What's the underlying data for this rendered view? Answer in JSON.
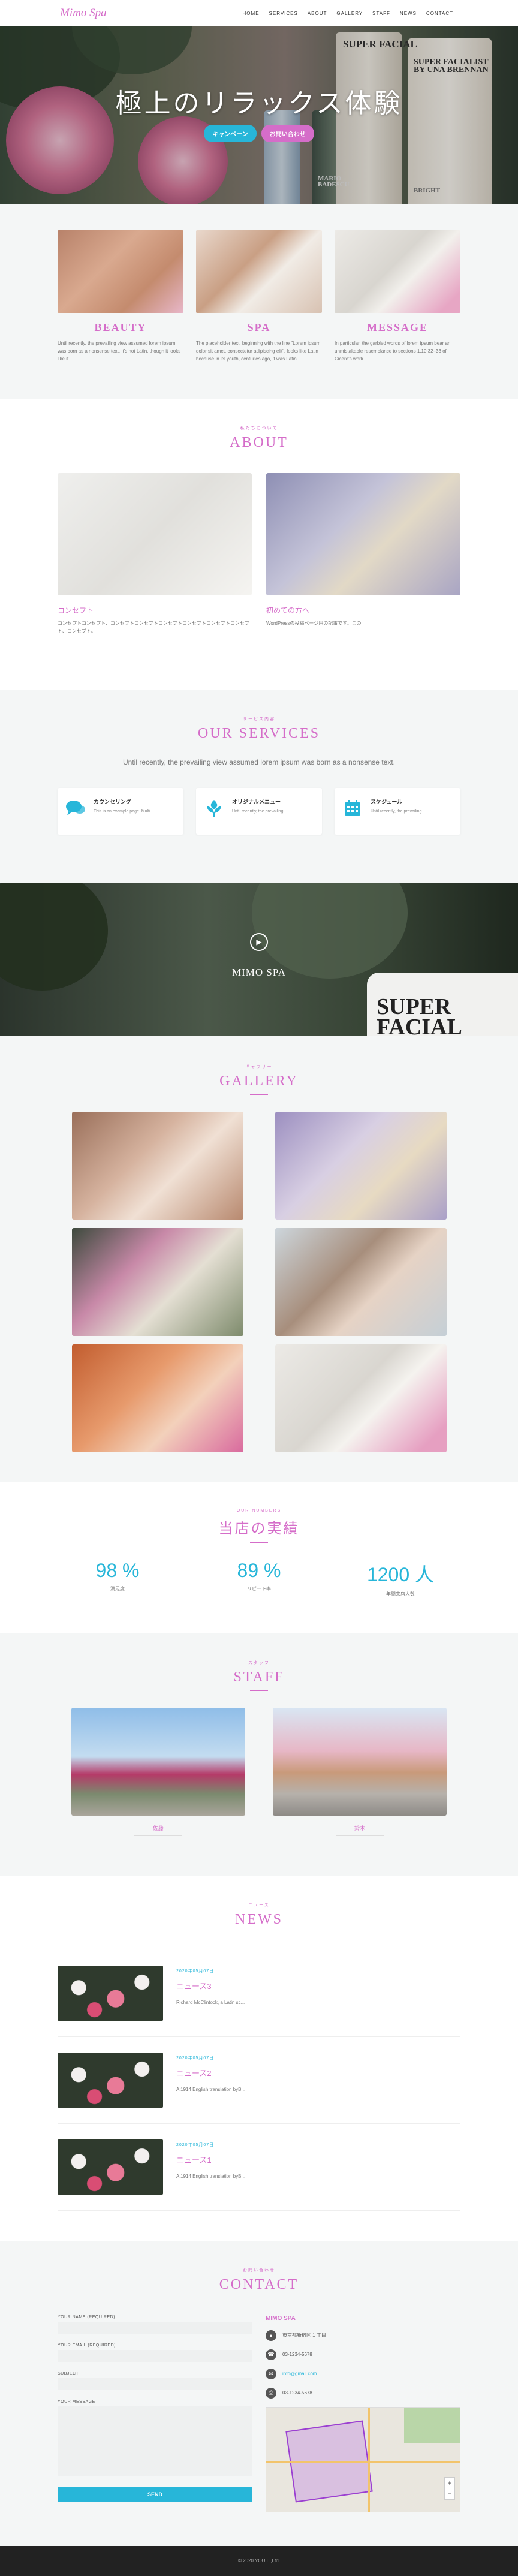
{
  "header": {
    "logo": "Mimo Spa",
    "nav": [
      "HOME",
      "SERVICES",
      "ABOUT",
      "GALLERY",
      "STAFF",
      "NEWS",
      "CONTACT"
    ]
  },
  "hero": {
    "title": "極上のリラックス体験",
    "btn_campaign": "キャンペーン",
    "btn_contact": "お問い合わせ",
    "bottle_text": "SUPER FACIAL",
    "bottle_text2": "SUPER FACIALIST BY UNA BRENNAN",
    "bottle_text3": "MARIO BADESCU",
    "bottle_text4": "BRIGHT"
  },
  "features": [
    {
      "title": "BEAUTY",
      "text": "Until recently, the prevailing view assumed lorem ipsum was born as a nonsense text. It's not Latin, though it looks like it"
    },
    {
      "title": "SPA",
      "text": "The placeholder text, beginning with the line \"Lorem ipsum dolor sit amet, consectetur adipiscing elit\", looks like Latin because in its youth, centuries ago, it was Latin."
    },
    {
      "title": "MESSAGE",
      "text": "In particular, the garbled words of lorem ipsum bear an unmistakable resemblance to sections 1.10.32–33 of Cicero's work"
    }
  ],
  "about": {
    "sub": "私たちについて",
    "title": "ABOUT",
    "cards": [
      {
        "title": "コンセプト",
        "text": "コンセプトコンセプト、コンセプトコンセプトコンセプトコンセプトコンセプトコンセプト、コンセプト。"
      },
      {
        "title": "初めての方へ",
        "text": "WordPressの投稿ページ用の記事です。この"
      }
    ]
  },
  "services": {
    "sub": "サービス内容",
    "title": "OUR SERVICES",
    "intro": "Until recently, the prevailing view assumed lorem ipsum was born as a nonsense text.",
    "items": [
      {
        "title": "カウンセリング",
        "text": "This is an example page. Multi...",
        "icon": "chat-icon"
      },
      {
        "title": "オリジナルメニュー",
        "text": "Until recently, the prevailing ...",
        "icon": "leaf-icon"
      },
      {
        "title": "スケジュール",
        "text": "Until recently, the prevailing ...",
        "icon": "calendar-icon"
      }
    ]
  },
  "video": {
    "title": "MIMO SPA",
    "tube_text": "SUPER FACIAL"
  },
  "gallery": {
    "sub": "ギャラリー",
    "title": "GALLERY"
  },
  "stats": {
    "sub": "OUR NUMBERS",
    "title": "当店の実績",
    "items": [
      {
        "value": "98 %",
        "label": "満足度"
      },
      {
        "value": "89 %",
        "label": "リピート率"
      },
      {
        "value": "1200 人",
        "label": "年間来店人数"
      }
    ]
  },
  "staff": {
    "sub": "スタッフ",
    "title": "STAFF",
    "members": [
      "佐藤",
      "鈴木"
    ]
  },
  "news": {
    "sub": "ニュース",
    "title": "NEWS",
    "items": [
      {
        "date": "2020年05月07日",
        "title": "ニュース3",
        "excerpt": "Richard McClintock, a Latin sc..."
      },
      {
        "date": "2020年05月07日",
        "title": "ニュース2",
        "excerpt": "A 1914 English translation byB..."
      },
      {
        "date": "2020年05月07日",
        "title": "ニュース1",
        "excerpt": "A 1914 English translation byB..."
      }
    ]
  },
  "contact": {
    "sub": "お問い合わせ",
    "title": "CONTACT",
    "labels": [
      "YOUR NAME (REQUIRED)",
      "YOUR EMAIL (REQUIRED)",
      "SUBJECT",
      "YOUR MESSAGE"
    ],
    "send": "SEND",
    "info_title": "MIMO SPA",
    "address": "東京都新宿区 1 丁目",
    "phone": "03-1234-5678",
    "email": "info@gmail.com",
    "fax": "03-1234-5678"
  },
  "footer": {
    "copyright": "© 2020 YOU.L.,Ltd."
  },
  "colors": {
    "pink": "#d56dc9",
    "cyan": "#27b6d9"
  }
}
